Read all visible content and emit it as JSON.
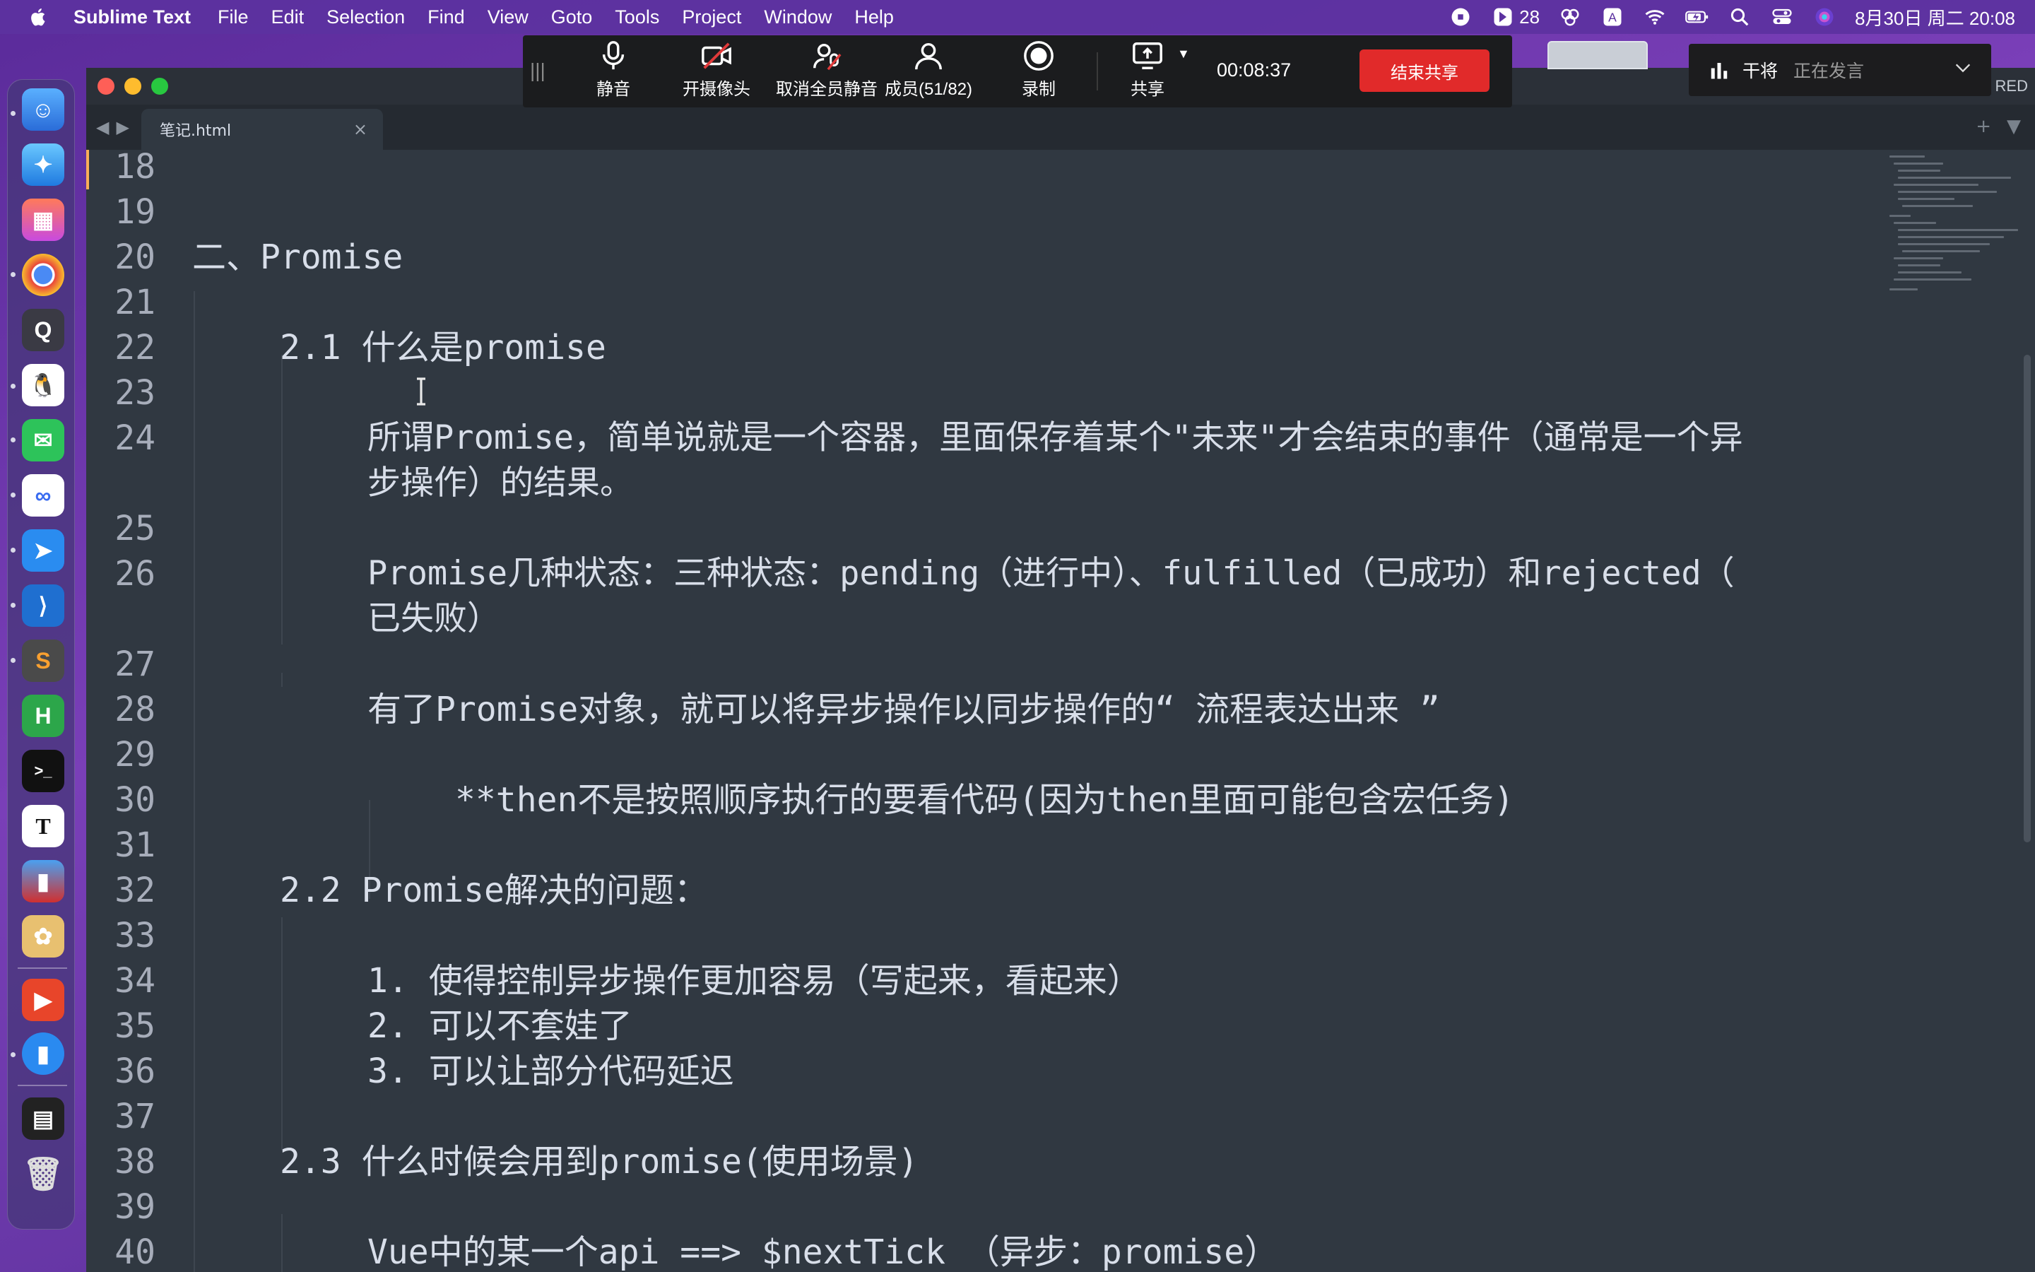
{
  "menubar": {
    "app_name": "Sublime Text",
    "items": [
      "File",
      "Edit",
      "Selection",
      "Find",
      "View",
      "Goto",
      "Tools",
      "Project",
      "Window",
      "Help"
    ],
    "badge_count": "28",
    "datetime": "8月30日 周二 20:08"
  },
  "meeting": {
    "mute_label": "静音",
    "camera_label": "开摄像头",
    "unmute_all_label": "取消全员静音",
    "members_label": "成员(51/82)",
    "record_label": "录制",
    "share_label": "共享",
    "timer": "00:08:37",
    "end_share_label": "结束共享"
  },
  "speaker": {
    "name": "干将",
    "status": "正在发言"
  },
  "window": {
    "right_label": "RED"
  },
  "tab": {
    "filename": "笔记.html"
  },
  "editor": {
    "lines": [
      {
        "num": "18",
        "text": ""
      },
      {
        "num": "19",
        "text": ""
      },
      {
        "num": "20",
        "text": "二、Promise"
      },
      {
        "num": "21",
        "text": ""
      },
      {
        "num": "22",
        "text": "2.1 什么是promise"
      },
      {
        "num": "23",
        "text": ""
      },
      {
        "num": "24",
        "text": "所谓Promise，简单说就是一个容器，里面保存着某个\"未来\"才会结束的事件（通常是一个异",
        "cont": "步操作）的结果。"
      },
      {
        "num": "25",
        "text": ""
      },
      {
        "num": "26",
        "text": "Promise几种状态：三种状态：pending（进行中）、fulfilled（已成功）和rejected（",
        "cont": "已失败）"
      },
      {
        "num": "27",
        "text": ""
      },
      {
        "num": "28",
        "text": "有了Promise对象，就可以将异步操作以同步操作的“ 流程表达出来 ”"
      },
      {
        "num": "29",
        "text": ""
      },
      {
        "num": "30",
        "text": "**then不是按照顺序执行的要看代码(因为then里面可能包含宏任务)"
      },
      {
        "num": "31",
        "text": ""
      },
      {
        "num": "32",
        "text": "2.2 Promise解决的问题："
      },
      {
        "num": "33",
        "text": ""
      },
      {
        "num": "34",
        "text": "1. 使得控制异步操作更加容易（写起来，看起来）"
      },
      {
        "num": "35",
        "text": "2. 可以不套娃了"
      },
      {
        "num": "36",
        "text": "3. 可以让部分代码延迟"
      },
      {
        "num": "37",
        "text": ""
      },
      {
        "num": "38",
        "text": "2.3 什么时候会用到promise(使用场景)"
      },
      {
        "num": "39",
        "text": ""
      },
      {
        "num": "40",
        "text": "Vue中的某一个api ==> $nextTick （异步：promise）"
      }
    ]
  },
  "colors": {
    "editor_bg": "#303841",
    "editor_text": "#d8dee9",
    "line_number": "#a7adba",
    "accent_orange": "#f9ae58",
    "end_share_red": "#e12a2a"
  },
  "icons": [
    "apple-icon",
    "microphone-icon",
    "camera-off-icon",
    "unmute-all-icon",
    "members-icon",
    "record-icon",
    "share-screen-icon",
    "wifi-icon",
    "battery-icon",
    "search-icon",
    "control-center-icon",
    "siri-icon"
  ]
}
